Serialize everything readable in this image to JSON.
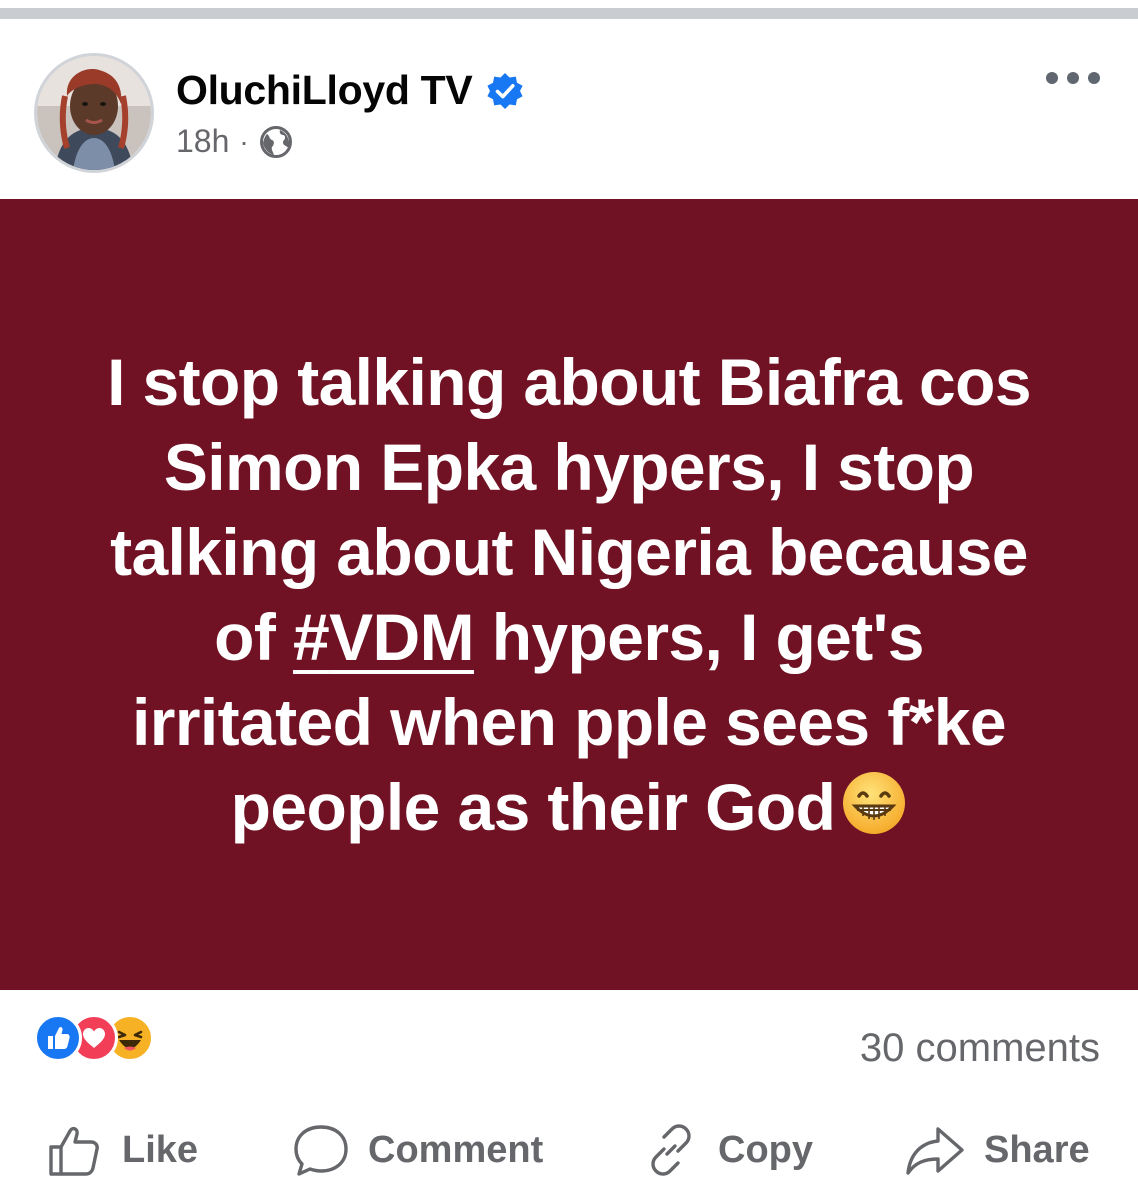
{
  "post": {
    "author": "OluchiLloyd TV",
    "verified": true,
    "time": "18h",
    "separator": "·",
    "audience_icon": "globe-icon",
    "more_icon": "more-options-icon",
    "text_part1": "I stop talking about Biafra cos Simon Epka hypers, I stop talking about Nigeria because of ",
    "hashtag_prefix": "#",
    "hashtag": "VDM",
    "text_part2": " hypers, I get's irritated when pple sees f*ke people as their God",
    "emoji": "grinning-face-emoji",
    "background_color": "#701224",
    "text_color": "#ffffff"
  },
  "stats": {
    "reactions": [
      "like",
      "love",
      "haha"
    ],
    "comments": "30 comments"
  },
  "actions": {
    "like": "Like",
    "comment": "Comment",
    "copy": "Copy",
    "share": "Share"
  },
  "colors": {
    "verified_blue": "#1877f2",
    "meta_gray": "#65676b",
    "love_red": "#f33e58",
    "haha_yellow": "#f7b125"
  }
}
